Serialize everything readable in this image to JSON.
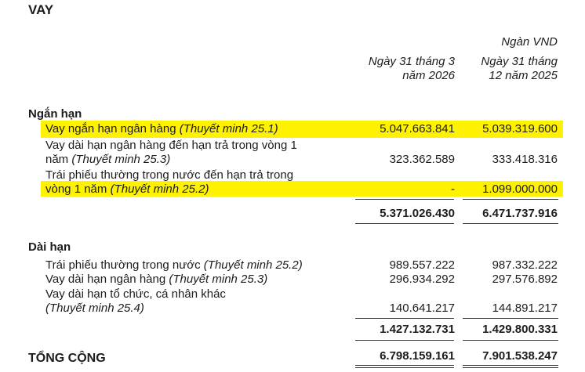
{
  "title": "VAY",
  "unit": "Ngàn VND",
  "col1": [
    "Ngày 31 tháng 3",
    "năm 2026"
  ],
  "col2": [
    "Ngày 31 tháng",
    "12 năm 2025"
  ],
  "short_term": {
    "heading": "Ngắn hạn",
    "rows": [
      {
        "label": "Vay ngắn hạn ngân hàng ",
        "note": "(Thuyết minh 25.1)",
        "v1": "5.047.663.841",
        "v2": "5.039.319.600"
      },
      {
        "label1": "Vay dài hạn ngân hàng đến hạn trả trong vòng 1",
        "label2": "năm ",
        "note": "(Thuyết minh 25.3)",
        "v1": "323.362.589",
        "v2": "333.418.316"
      },
      {
        "label1": "Trái phiếu thường trong nước đến hạn trả trong",
        "label2": "vòng 1 năm ",
        "note": "(Thuyết minh 25.2)",
        "v1": "-",
        "v2": "1.099.000.000"
      }
    ],
    "total1": "5.371.026.430",
    "total2": "6.471.737.916"
  },
  "long_term": {
    "heading": "Dài hạn",
    "rows": [
      {
        "label": "Trái phiếu thường trong nước ",
        "note": "(Thuyết minh 25.2)",
        "v1": "989.557.222",
        "v2": "987.332.222"
      },
      {
        "label": "Vay dài hạn ngân hàng ",
        "note": "(Thuyết minh 25.3)",
        "v1": "296.934.292",
        "v2": "297.576.892"
      },
      {
        "label1": "Vay dài hạn tổ chức, cá nhân khác",
        "note": "(Thuyết minh 25.4)",
        "v1": "140.641.217",
        "v2": "144.891.217"
      }
    ],
    "total1": "1.427.132.731",
    "total2": "1.429.800.331"
  },
  "grand_total": {
    "label": "TỔNG CỘNG",
    "v1": "6.798.159.161",
    "v2": "7.901.538.247"
  },
  "highlight_color": "#fff200"
}
